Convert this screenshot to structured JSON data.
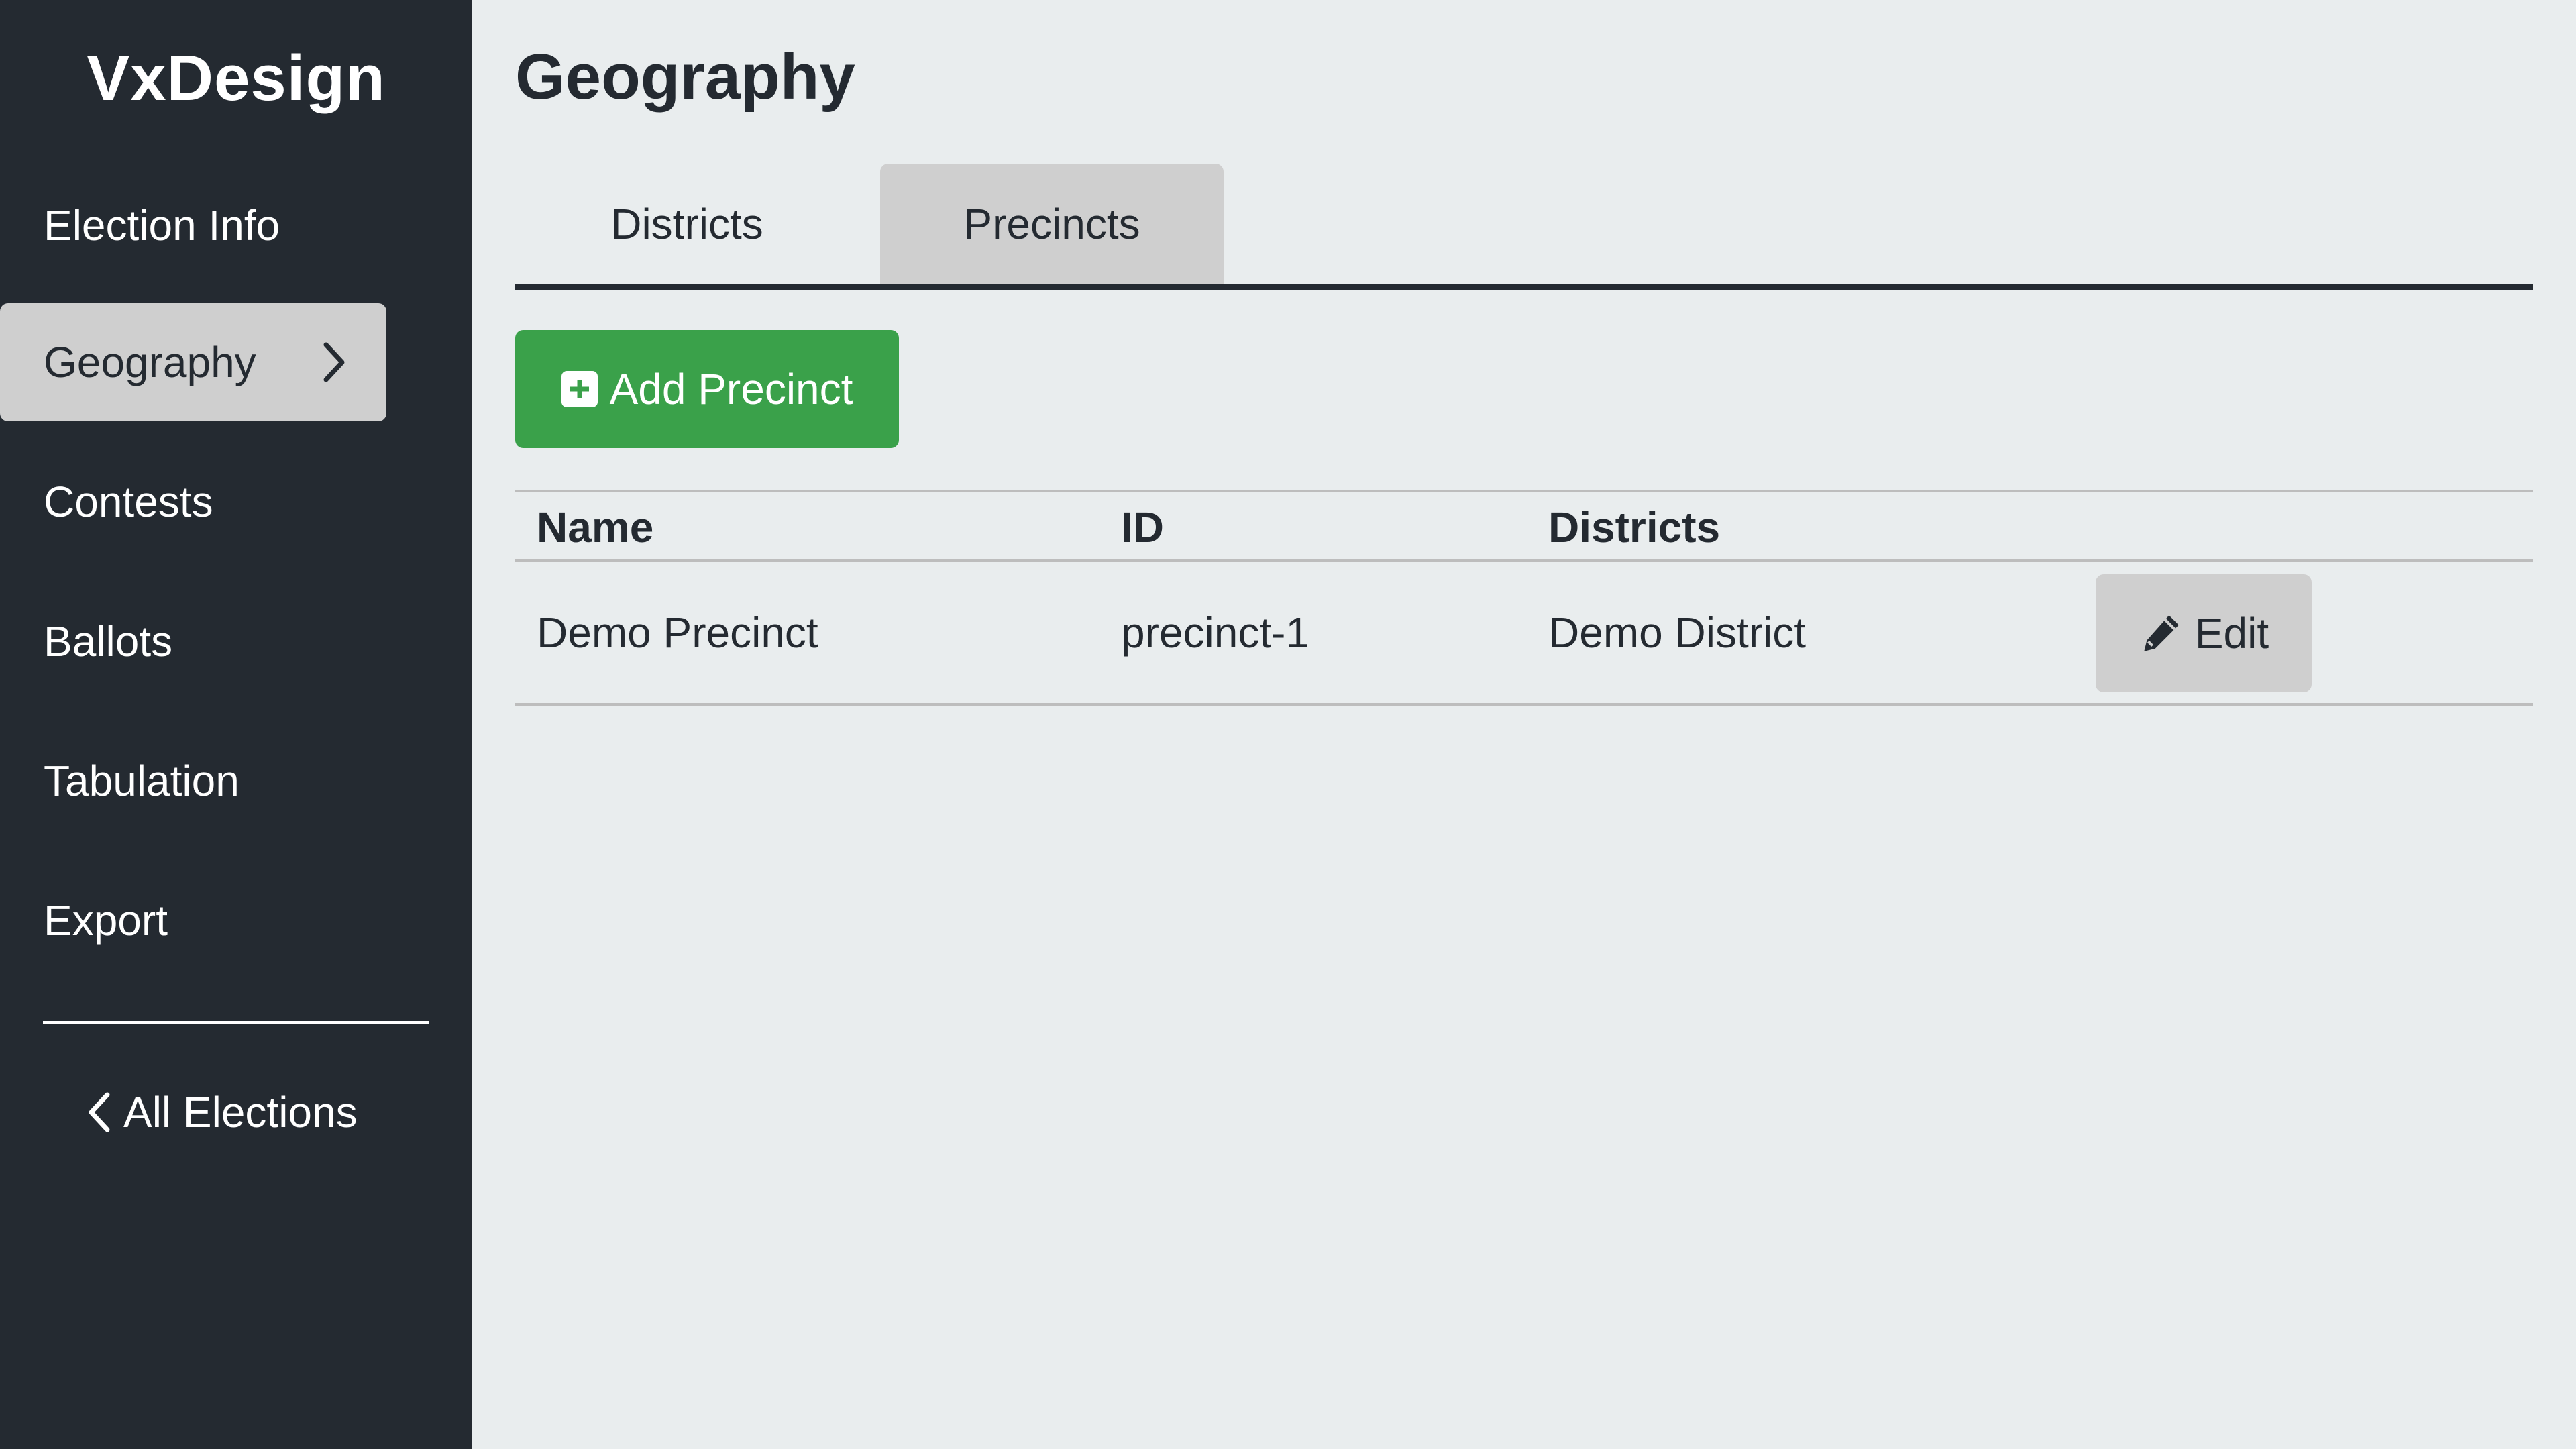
{
  "app": {
    "brand": "VxDesign"
  },
  "sidebar": {
    "items": [
      {
        "label": "Election Info",
        "active": false
      },
      {
        "label": "Geography",
        "active": true
      },
      {
        "label": "Contests",
        "active": false
      },
      {
        "label": "Ballots",
        "active": false
      },
      {
        "label": "Tabulation",
        "active": false
      },
      {
        "label": "Export",
        "active": false
      }
    ],
    "back_label": "All Elections"
  },
  "main": {
    "title": "Geography",
    "tabs": [
      {
        "label": "Districts",
        "selected": false
      },
      {
        "label": "Precincts",
        "selected": true
      }
    ],
    "add_button_label": "Add Precinct",
    "table": {
      "columns": [
        "Name",
        "ID",
        "Districts"
      ],
      "rows": [
        {
          "name": "Demo Precinct",
          "id": "precinct-1",
          "districts": "Demo District",
          "action_label": "Edit"
        }
      ]
    }
  },
  "colors": {
    "sidebar_bg": "#242a31",
    "page_bg": "#e9edee",
    "active_item_bg": "#cfcfcf",
    "primary_button": "#3aa14a"
  },
  "icons": [
    "chevron-right-icon",
    "chevron-left-icon",
    "plus-square-icon",
    "pencil-icon"
  ]
}
